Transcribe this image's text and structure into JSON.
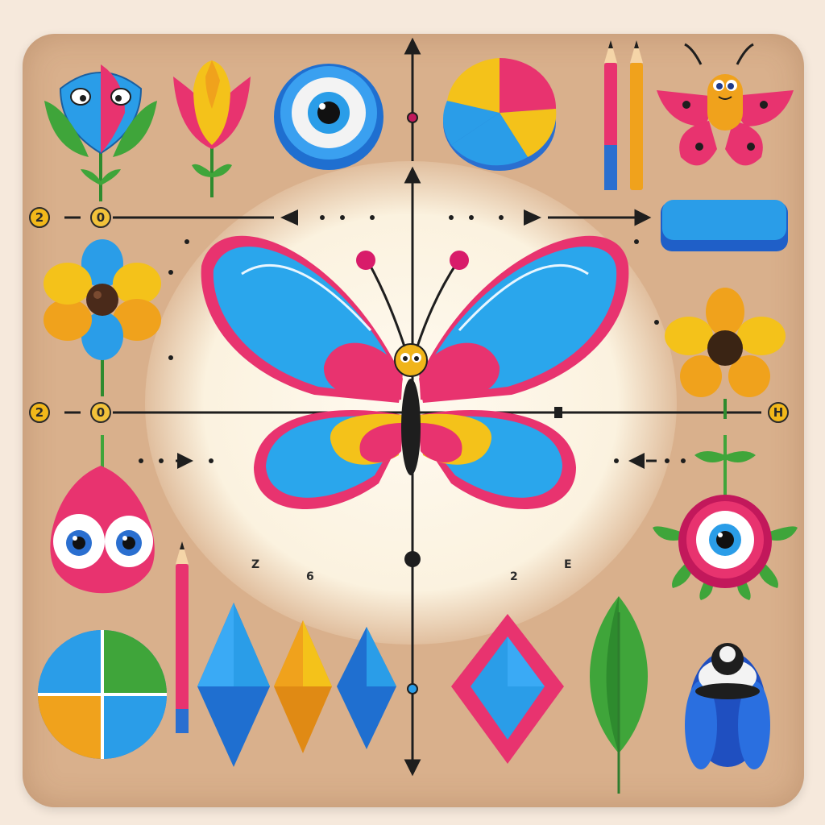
{
  "badges": {
    "top_left": "2",
    "top_left_b": "0",
    "mid_left": "2",
    "mid_left_b": "0",
    "mid_right": "H"
  },
  "axis_labels": {
    "a": "Z",
    "b": "6",
    "c": "2",
    "d": "E"
  },
  "colors": {
    "board": "#d9b08c",
    "pink": "#e8336f",
    "blue": "#2a9de8",
    "yellow": "#f4c21a",
    "orange": "#f0a21c",
    "green": "#3fa53a",
    "ink": "#1e1e1e"
  },
  "icons": [
    "bud-face-icon",
    "tulip-icon",
    "eye-button-icon",
    "pie-disc-icon",
    "pencils-icon",
    "small-butterfly-icon",
    "blue-bar-icon",
    "flower-left-icon",
    "flower-right-icon",
    "butterfly-icon",
    "drop-face-icon",
    "pencil-icon",
    "eye-flower-icon",
    "quad-circle-icon",
    "blue-diamond-icon",
    "orange-diamond-icon",
    "blue-diamond-small-icon",
    "framed-diamond-icon",
    "leaf-icon",
    "beetle-icon"
  ]
}
